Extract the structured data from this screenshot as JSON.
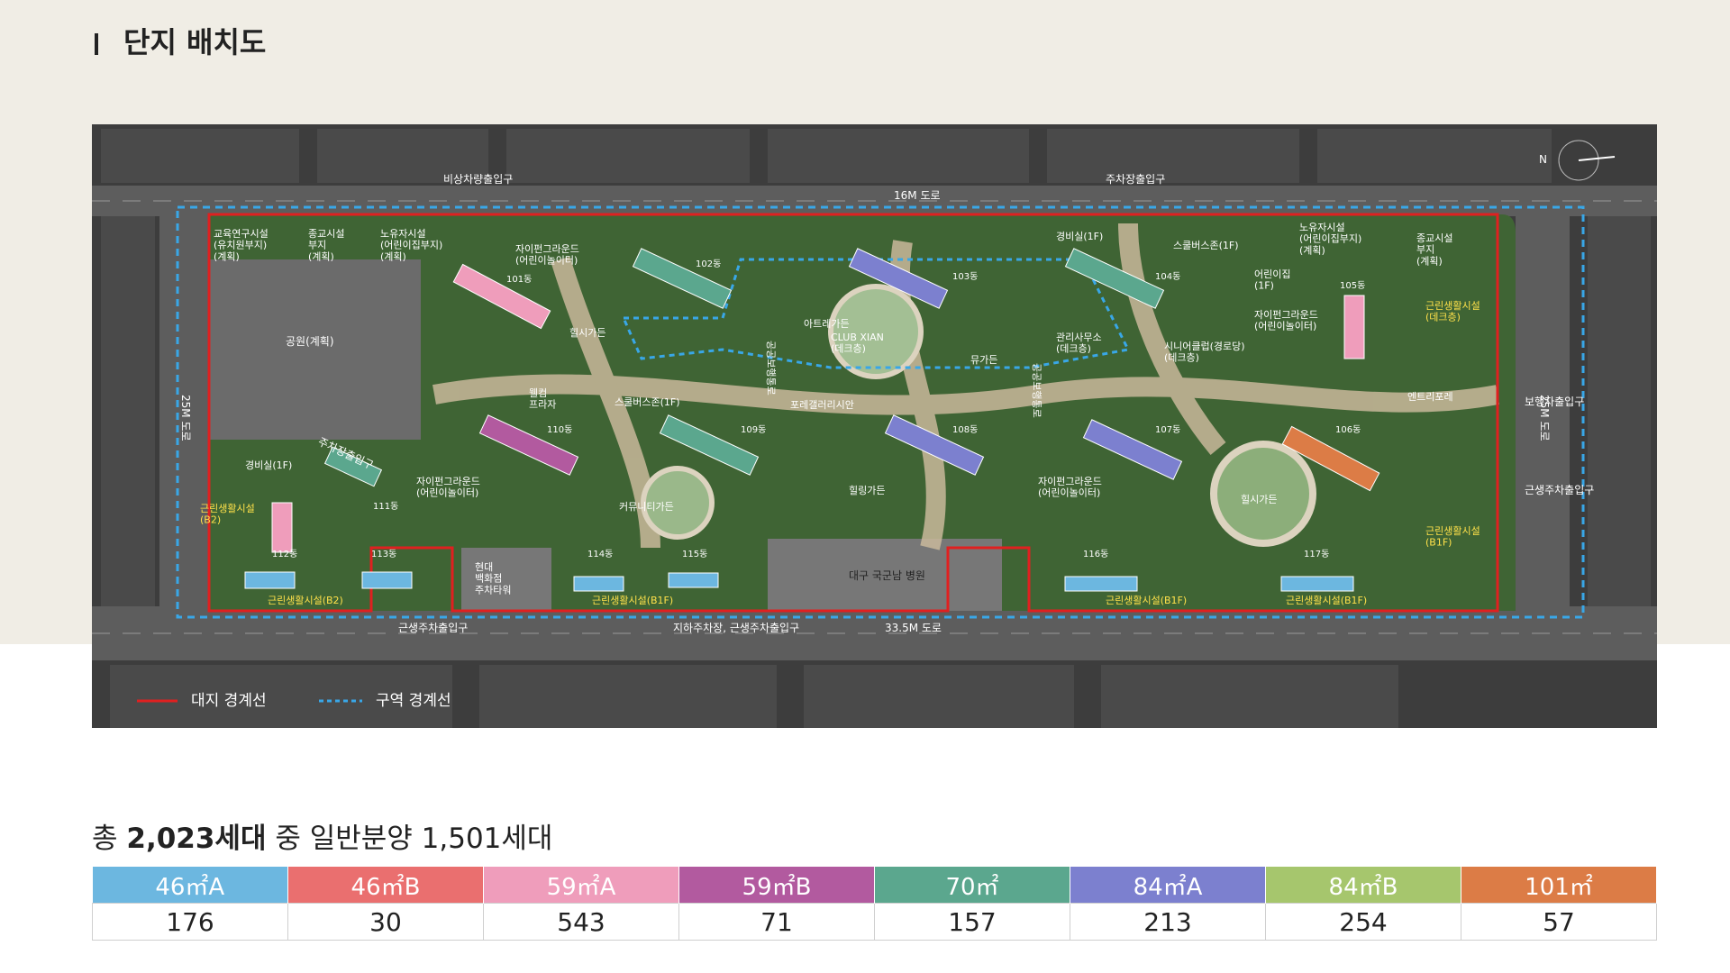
{
  "header": {
    "title": "단지 배치도"
  },
  "map": {
    "roads": {
      "north": "16M 도로",
      "south": "33.5M 도로",
      "west": "25M 도로",
      "east": "25M 도로"
    },
    "entrances": {
      "emergency": "비상차량출입구",
      "parking_north": "주차장출입구",
      "parking_west": "주차장출입구",
      "pedestrian_east": "보행자출입구",
      "retail_east": "근생주차출입구",
      "retail_south": "근생주차출입구",
      "underground": "지하주차장, 근생주차출입구"
    },
    "zones": {
      "edu": "교육연구시설\n(유치원부지)\n(계획)",
      "religion": "종교시설\n부지\n(계획)",
      "senior": "노유자시설\n(어린이집부지)\n(계획)",
      "park": "공원(계획)",
      "senior_ne": "노유자시설\n(어린이집부지)\n(계획)",
      "religion_ne": "종교시설\n부지\n(계획)",
      "hospital": "대구 국군남 병원",
      "modern": "현대\n백화점\n주차타워",
      "daycare": "어린이집\n(1F)",
      "guard_n": "경비실(1F)",
      "guard_w": "경비실(1F)",
      "bus_n": "스쿨버스존(1F)",
      "bus_c": "스쿨버스존(1F)",
      "welcome": "웰컴\n프라자",
      "entrance_plaza": "엔트리포레"
    },
    "facilities": {
      "club": "CLUB XIAN\n(데크층)",
      "office": "관리사무소\n(데크층)",
      "senior_club": "시니어클럽(경로당)\n(데크층)",
      "retail_ne": "근린생활시설\n(데크층)",
      "retail_w": "근린생활시설\n(B2)",
      "retail_e": "근린생활시설\n(B1F)",
      "retail_s1": "근린생활시설(B2)",
      "retail_s2": "근린생활시설(B1F)",
      "retail_s3": "근린생활시설(B1F)",
      "retail_s4": "근린생활시설(B1F)"
    },
    "gardens": {
      "g1": "자이펀그라운드\n(어린이놀이터)",
      "g2": "자이펀그라운드\n(어린이놀이터)",
      "g3": "자이펀그라운드\n(어린이놀이터)",
      "g4": "자이펀그라운드\n(어린이놀이터)",
      "h1": "힐시가든",
      "h2": "힐링가든",
      "h3": "힐시가든",
      "atrium": "아트레가든",
      "muse": "뮤가든",
      "forest": "포레갤러리시안",
      "community": "커뮤니티가든",
      "path1": "공공보행통로",
      "path2": "공공보행통로"
    },
    "buildings": [
      "101동",
      "102동",
      "103동",
      "104동",
      "105동",
      "106동",
      "107동",
      "108동",
      "109동",
      "110동",
      "111동",
      "112동",
      "113동",
      "114동",
      "115동",
      "116동",
      "117동"
    ],
    "compass": "N",
    "legend": {
      "site_boundary": "대지 경계선",
      "zone_boundary": "구역 경계선"
    }
  },
  "summary": {
    "total_prefix": "총 ",
    "total": "2,023세대",
    "middle": " 중 ",
    "general": "일반분양 1,501세대"
  },
  "units": [
    {
      "type": "46㎡A",
      "count": "176",
      "color": "#6cb7e0"
    },
    {
      "type": "46㎡B",
      "count": "30",
      "color": "#ea6f6f"
    },
    {
      "type": "59㎡A",
      "count": "543",
      "color": "#ef9dbb"
    },
    {
      "type": "59㎡B",
      "count": "71",
      "color": "#b25a9f"
    },
    {
      "type": "70㎡",
      "count": "157",
      "color": "#5ba78e"
    },
    {
      "type": "84㎡A",
      "count": "213",
      "color": "#7c80cf"
    },
    {
      "type": "84㎡B",
      "count": "254",
      "color": "#a6c66d"
    },
    {
      "type": "101㎡",
      "count": "57",
      "color": "#dc7c46"
    }
  ]
}
